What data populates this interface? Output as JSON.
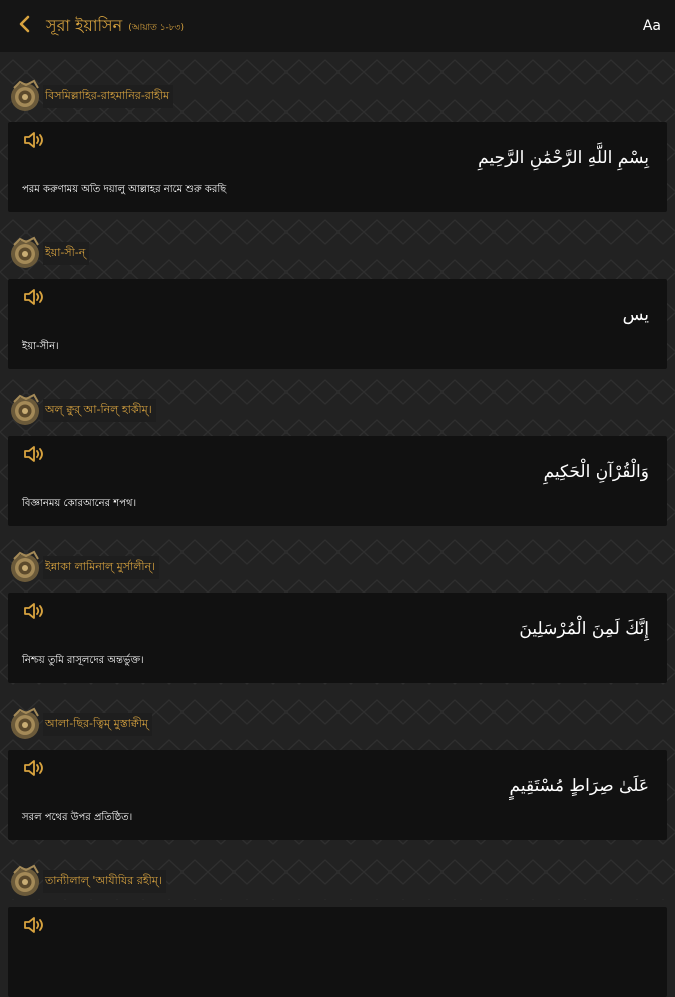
{
  "header": {
    "back_icon": "chevron-left-icon",
    "title": "সূরা ইয়াসিন",
    "subtitle": "(আয়াত ১-৮৩)",
    "font_button": "Aa"
  },
  "colors": {
    "accent": "#d8a33f",
    "background": "#222222",
    "topbar": "#151515",
    "card": "#111111",
    "text": "#ffffff"
  },
  "ayahs": [
    {
      "transliteration": "বিসমিল্লাহির-রাহমানির-রাহীম",
      "arabic": "بِسْمِ اللَّهِ الرَّحْمَٰنِ الرَّحِيمِ",
      "meaning": "পরম করুণাময় অতি দয়ালু আল্লাহর নামে শুরু করছি"
    },
    {
      "transliteration": "ইয়া-সী-ন্",
      "arabic": "يس",
      "meaning": "ইয়া-সীন।"
    },
    {
      "transliteration": "অল্ ক্বুর্ আ-নিল্ হাকীম্।",
      "arabic": "وَالْقُرْآنِ الْحَكِيمِ",
      "meaning": "বিজ্ঞানময় কোরআনের শপথ।"
    },
    {
      "transliteration": "ইন্নাকা লামিনাল্ মুর্সালীন্।",
      "arabic": "إِنَّكَ لَمِنَ الْمُرْسَلِينَ",
      "meaning": "নিশ্চয় তুমি রাসূলদের অন্তর্ভুক্ত।"
    },
    {
      "transliteration": "আলা-ছির-ত্বিম্ মুস্তাক্বীম্",
      "arabic": "عَلَىٰ صِرَاطٍ مُسْتَقِيمٍ",
      "meaning": "সরল পথের উপর প্রতিষ্ঠিত।"
    },
    {
      "transliteration": "তান্যীলাল্ 'আযীযির রহীম্।",
      "arabic": "",
      "meaning": ""
    }
  ]
}
